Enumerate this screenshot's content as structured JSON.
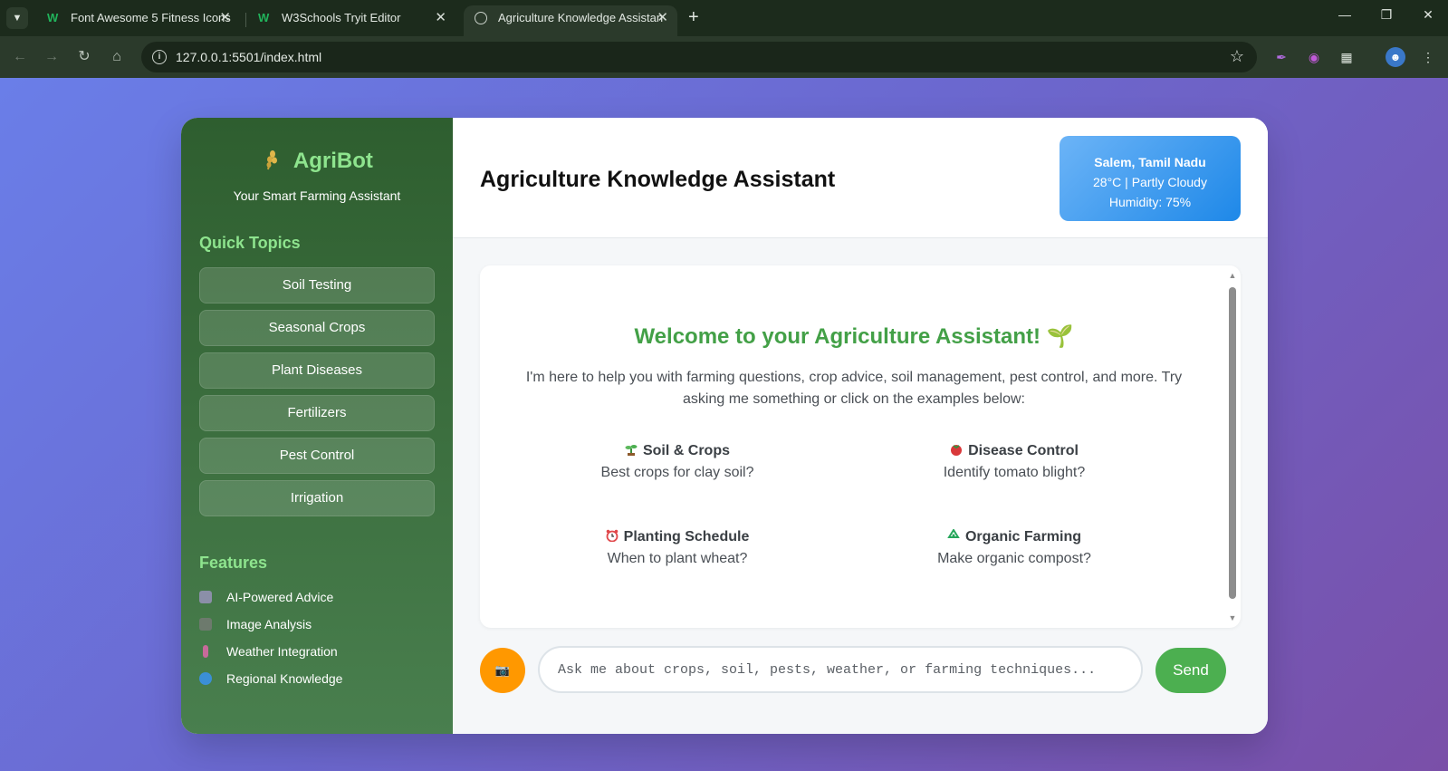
{
  "browser": {
    "tabs": [
      {
        "title": "Font Awesome 5 Fitness Icons",
        "icon": "w3schools-icon"
      },
      {
        "title": "W3Schools Tryit Editor",
        "icon": "w3schools-icon"
      },
      {
        "title": "Agriculture Knowledge Assistan",
        "icon": "globe-icon"
      }
    ],
    "favicon_letter": "W",
    "new_tab": "+",
    "url": "127.0.0.1:5501/index.html"
  },
  "sidebar": {
    "brand": "AgriBot",
    "tagline": "Your Smart Farming Assistant",
    "quick_topics_title": "Quick Topics",
    "topics": [
      "Soil Testing",
      "Seasonal Crops",
      "Plant Diseases",
      "Fertilizers",
      "Pest Control",
      "Irrigation"
    ],
    "features_title": "Features",
    "features": [
      {
        "label": "AI-Powered Advice",
        "icon": "robot-icon",
        "color": "#8b8fa8"
      },
      {
        "label": "Image Analysis",
        "icon": "camera-icon",
        "color": "#6d7a6d"
      },
      {
        "label": "Weather Integration",
        "icon": "thermometer-icon",
        "color": "#c76a9a"
      },
      {
        "label": "Regional Knowledge",
        "icon": "globe-icon",
        "color": "#3b8fd6"
      }
    ]
  },
  "header": {
    "title": "Agriculture Knowledge Assistant",
    "weather": {
      "location": "Salem, Tamil Nadu",
      "conditions": "28°C | Partly Cloudy",
      "humidity": "Humidity: 75%"
    }
  },
  "chat": {
    "welcome_title": "Welcome to your Agriculture Assistant! 🌱",
    "welcome_text": "I'm here to help you with farming questions, crop advice, soil management, pest control, and more. Try asking me something or click on the examples below:",
    "examples": [
      {
        "title": "Soil & Crops",
        "text": "Best crops for clay soil?",
        "icon": "seedling-icon"
      },
      {
        "title": "Disease Control",
        "text": "Identify tomato blight?",
        "icon": "tomato-icon"
      },
      {
        "title": "Planting Schedule",
        "text": "When to plant wheat?",
        "icon": "alarm-clock-icon"
      },
      {
        "title": "Organic Farming",
        "text": "Make organic compost?",
        "icon": "recycle-icon"
      }
    ]
  },
  "input": {
    "placeholder": "Ask me about crops, soil, pests, weather, or farming techniques...",
    "send_label": "Send",
    "camera_icon": "📷"
  },
  "colors": {
    "accent_green": "#4caf50",
    "brand_green": "#8ee48e",
    "camera_orange": "#ff9800",
    "weather_blue": "#1e88e8"
  }
}
